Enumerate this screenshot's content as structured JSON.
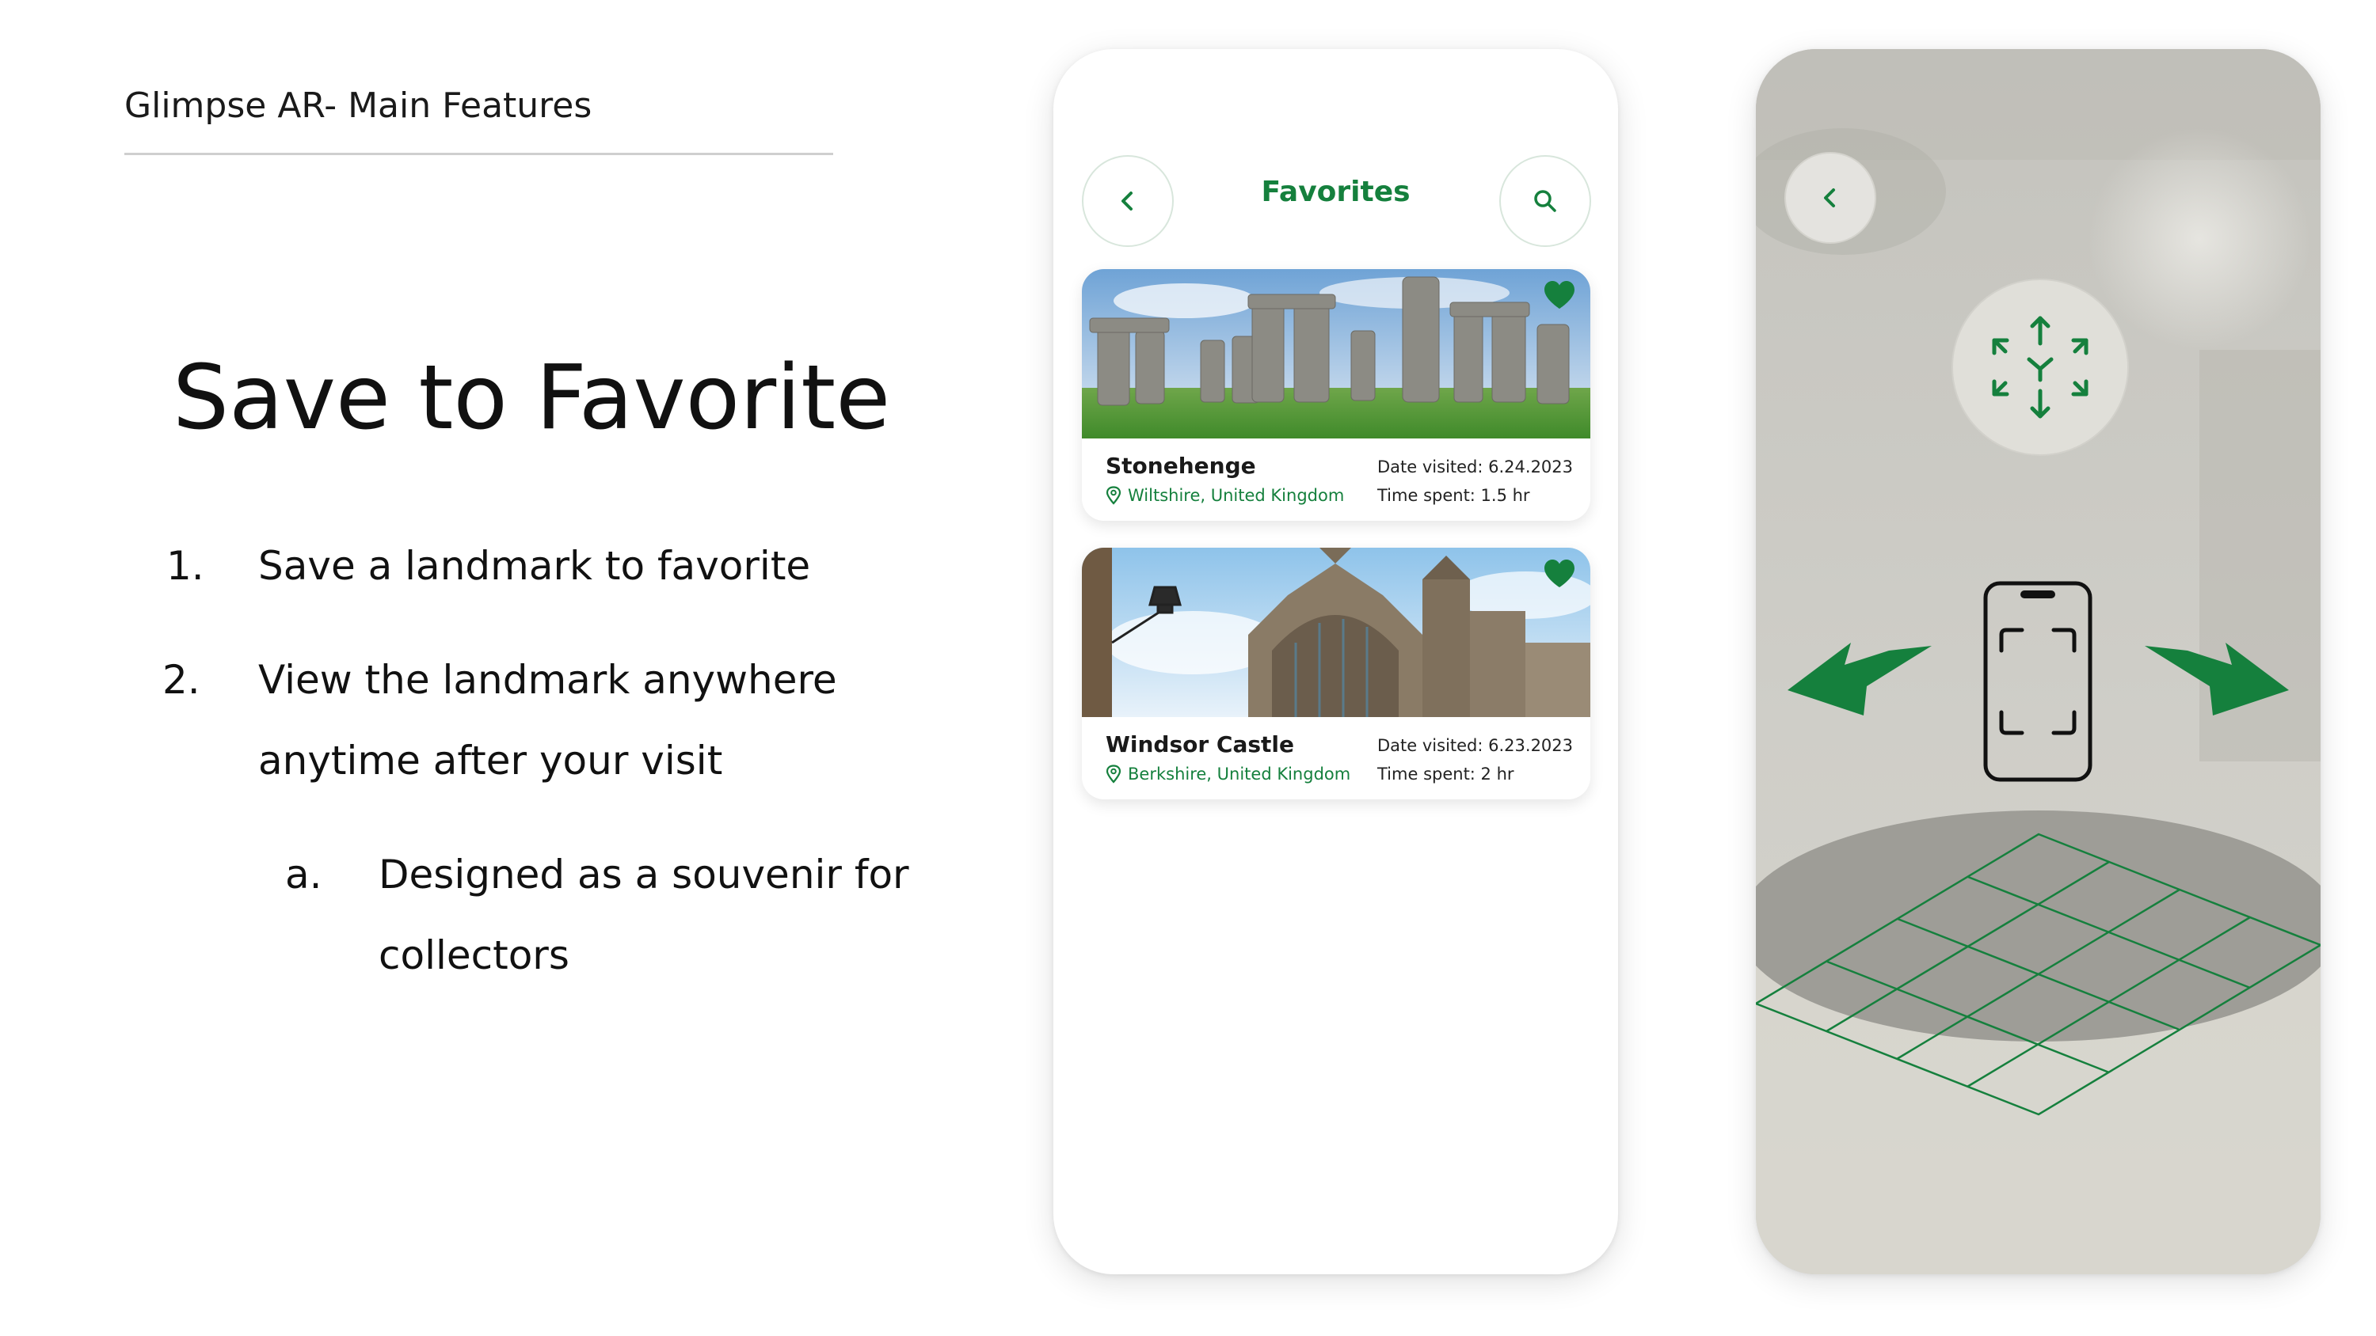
{
  "slide": {
    "header": "Glimpse AR- Main Features",
    "title": "Save to Favorite",
    "items": [
      {
        "num": "1.",
        "line1": "Save a landmark to favorite"
      },
      {
        "num": "2.",
        "line1": "View the landmark anywhere",
        "line2": "anytime after your visit"
      },
      {
        "num": "a.",
        "line1": "Designed as a souvenir for",
        "line2": "collectors"
      }
    ]
  },
  "favorites_screen": {
    "title": "Favorites",
    "back_icon": "chevron-left-icon",
    "search_icon": "search-icon",
    "cards": [
      {
        "name": "Stonehenge",
        "location": "Wiltshire, United Kingdom",
        "date": "Date visited: 6.24.2023",
        "time": "Time spent: 1.5 hr"
      },
      {
        "name": "Windsor Castle",
        "location": "Berkshire, United Kingdom",
        "date": "Date visited: 6.23.2023",
        "time": "Time spent: 2 hr"
      }
    ]
  },
  "ar_screen": {
    "back_icon": "chevron-left-icon",
    "ar_icon": "ar-cube-icon",
    "phone_icon": "phone-scan-icon"
  },
  "colors": {
    "accent": "#15803d",
    "text": "#111111"
  }
}
